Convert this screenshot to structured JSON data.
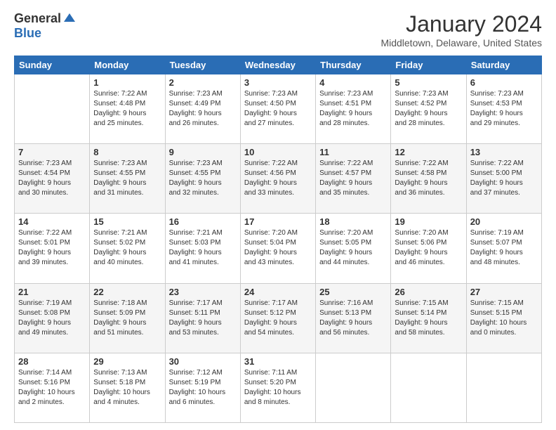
{
  "header": {
    "logo_general": "General",
    "logo_blue": "Blue",
    "title": "January 2024",
    "location": "Middletown, Delaware, United States"
  },
  "weekdays": [
    "Sunday",
    "Monday",
    "Tuesday",
    "Wednesday",
    "Thursday",
    "Friday",
    "Saturday"
  ],
  "weeks": [
    [
      {
        "day": "",
        "info": ""
      },
      {
        "day": "1",
        "info": "Sunrise: 7:22 AM\nSunset: 4:48 PM\nDaylight: 9 hours\nand 25 minutes."
      },
      {
        "day": "2",
        "info": "Sunrise: 7:23 AM\nSunset: 4:49 PM\nDaylight: 9 hours\nand 26 minutes."
      },
      {
        "day": "3",
        "info": "Sunrise: 7:23 AM\nSunset: 4:50 PM\nDaylight: 9 hours\nand 27 minutes."
      },
      {
        "day": "4",
        "info": "Sunrise: 7:23 AM\nSunset: 4:51 PM\nDaylight: 9 hours\nand 28 minutes."
      },
      {
        "day": "5",
        "info": "Sunrise: 7:23 AM\nSunset: 4:52 PM\nDaylight: 9 hours\nand 28 minutes."
      },
      {
        "day": "6",
        "info": "Sunrise: 7:23 AM\nSunset: 4:53 PM\nDaylight: 9 hours\nand 29 minutes."
      }
    ],
    [
      {
        "day": "7",
        "info": "Sunrise: 7:23 AM\nSunset: 4:54 PM\nDaylight: 9 hours\nand 30 minutes."
      },
      {
        "day": "8",
        "info": "Sunrise: 7:23 AM\nSunset: 4:55 PM\nDaylight: 9 hours\nand 31 minutes."
      },
      {
        "day": "9",
        "info": "Sunrise: 7:23 AM\nSunset: 4:55 PM\nDaylight: 9 hours\nand 32 minutes."
      },
      {
        "day": "10",
        "info": "Sunrise: 7:22 AM\nSunset: 4:56 PM\nDaylight: 9 hours\nand 33 minutes."
      },
      {
        "day": "11",
        "info": "Sunrise: 7:22 AM\nSunset: 4:57 PM\nDaylight: 9 hours\nand 35 minutes."
      },
      {
        "day": "12",
        "info": "Sunrise: 7:22 AM\nSunset: 4:58 PM\nDaylight: 9 hours\nand 36 minutes."
      },
      {
        "day": "13",
        "info": "Sunrise: 7:22 AM\nSunset: 5:00 PM\nDaylight: 9 hours\nand 37 minutes."
      }
    ],
    [
      {
        "day": "14",
        "info": "Sunrise: 7:22 AM\nSunset: 5:01 PM\nDaylight: 9 hours\nand 39 minutes."
      },
      {
        "day": "15",
        "info": "Sunrise: 7:21 AM\nSunset: 5:02 PM\nDaylight: 9 hours\nand 40 minutes."
      },
      {
        "day": "16",
        "info": "Sunrise: 7:21 AM\nSunset: 5:03 PM\nDaylight: 9 hours\nand 41 minutes."
      },
      {
        "day": "17",
        "info": "Sunrise: 7:20 AM\nSunset: 5:04 PM\nDaylight: 9 hours\nand 43 minutes."
      },
      {
        "day": "18",
        "info": "Sunrise: 7:20 AM\nSunset: 5:05 PM\nDaylight: 9 hours\nand 44 minutes."
      },
      {
        "day": "19",
        "info": "Sunrise: 7:20 AM\nSunset: 5:06 PM\nDaylight: 9 hours\nand 46 minutes."
      },
      {
        "day": "20",
        "info": "Sunrise: 7:19 AM\nSunset: 5:07 PM\nDaylight: 9 hours\nand 48 minutes."
      }
    ],
    [
      {
        "day": "21",
        "info": "Sunrise: 7:19 AM\nSunset: 5:08 PM\nDaylight: 9 hours\nand 49 minutes."
      },
      {
        "day": "22",
        "info": "Sunrise: 7:18 AM\nSunset: 5:09 PM\nDaylight: 9 hours\nand 51 minutes."
      },
      {
        "day": "23",
        "info": "Sunrise: 7:17 AM\nSunset: 5:11 PM\nDaylight: 9 hours\nand 53 minutes."
      },
      {
        "day": "24",
        "info": "Sunrise: 7:17 AM\nSunset: 5:12 PM\nDaylight: 9 hours\nand 54 minutes."
      },
      {
        "day": "25",
        "info": "Sunrise: 7:16 AM\nSunset: 5:13 PM\nDaylight: 9 hours\nand 56 minutes."
      },
      {
        "day": "26",
        "info": "Sunrise: 7:15 AM\nSunset: 5:14 PM\nDaylight: 9 hours\nand 58 minutes."
      },
      {
        "day": "27",
        "info": "Sunrise: 7:15 AM\nSunset: 5:15 PM\nDaylight: 10 hours\nand 0 minutes."
      }
    ],
    [
      {
        "day": "28",
        "info": "Sunrise: 7:14 AM\nSunset: 5:16 PM\nDaylight: 10 hours\nand 2 minutes."
      },
      {
        "day": "29",
        "info": "Sunrise: 7:13 AM\nSunset: 5:18 PM\nDaylight: 10 hours\nand 4 minutes."
      },
      {
        "day": "30",
        "info": "Sunrise: 7:12 AM\nSunset: 5:19 PM\nDaylight: 10 hours\nand 6 minutes."
      },
      {
        "day": "31",
        "info": "Sunrise: 7:11 AM\nSunset: 5:20 PM\nDaylight: 10 hours\nand 8 minutes."
      },
      {
        "day": "",
        "info": ""
      },
      {
        "day": "",
        "info": ""
      },
      {
        "day": "",
        "info": ""
      }
    ]
  ]
}
